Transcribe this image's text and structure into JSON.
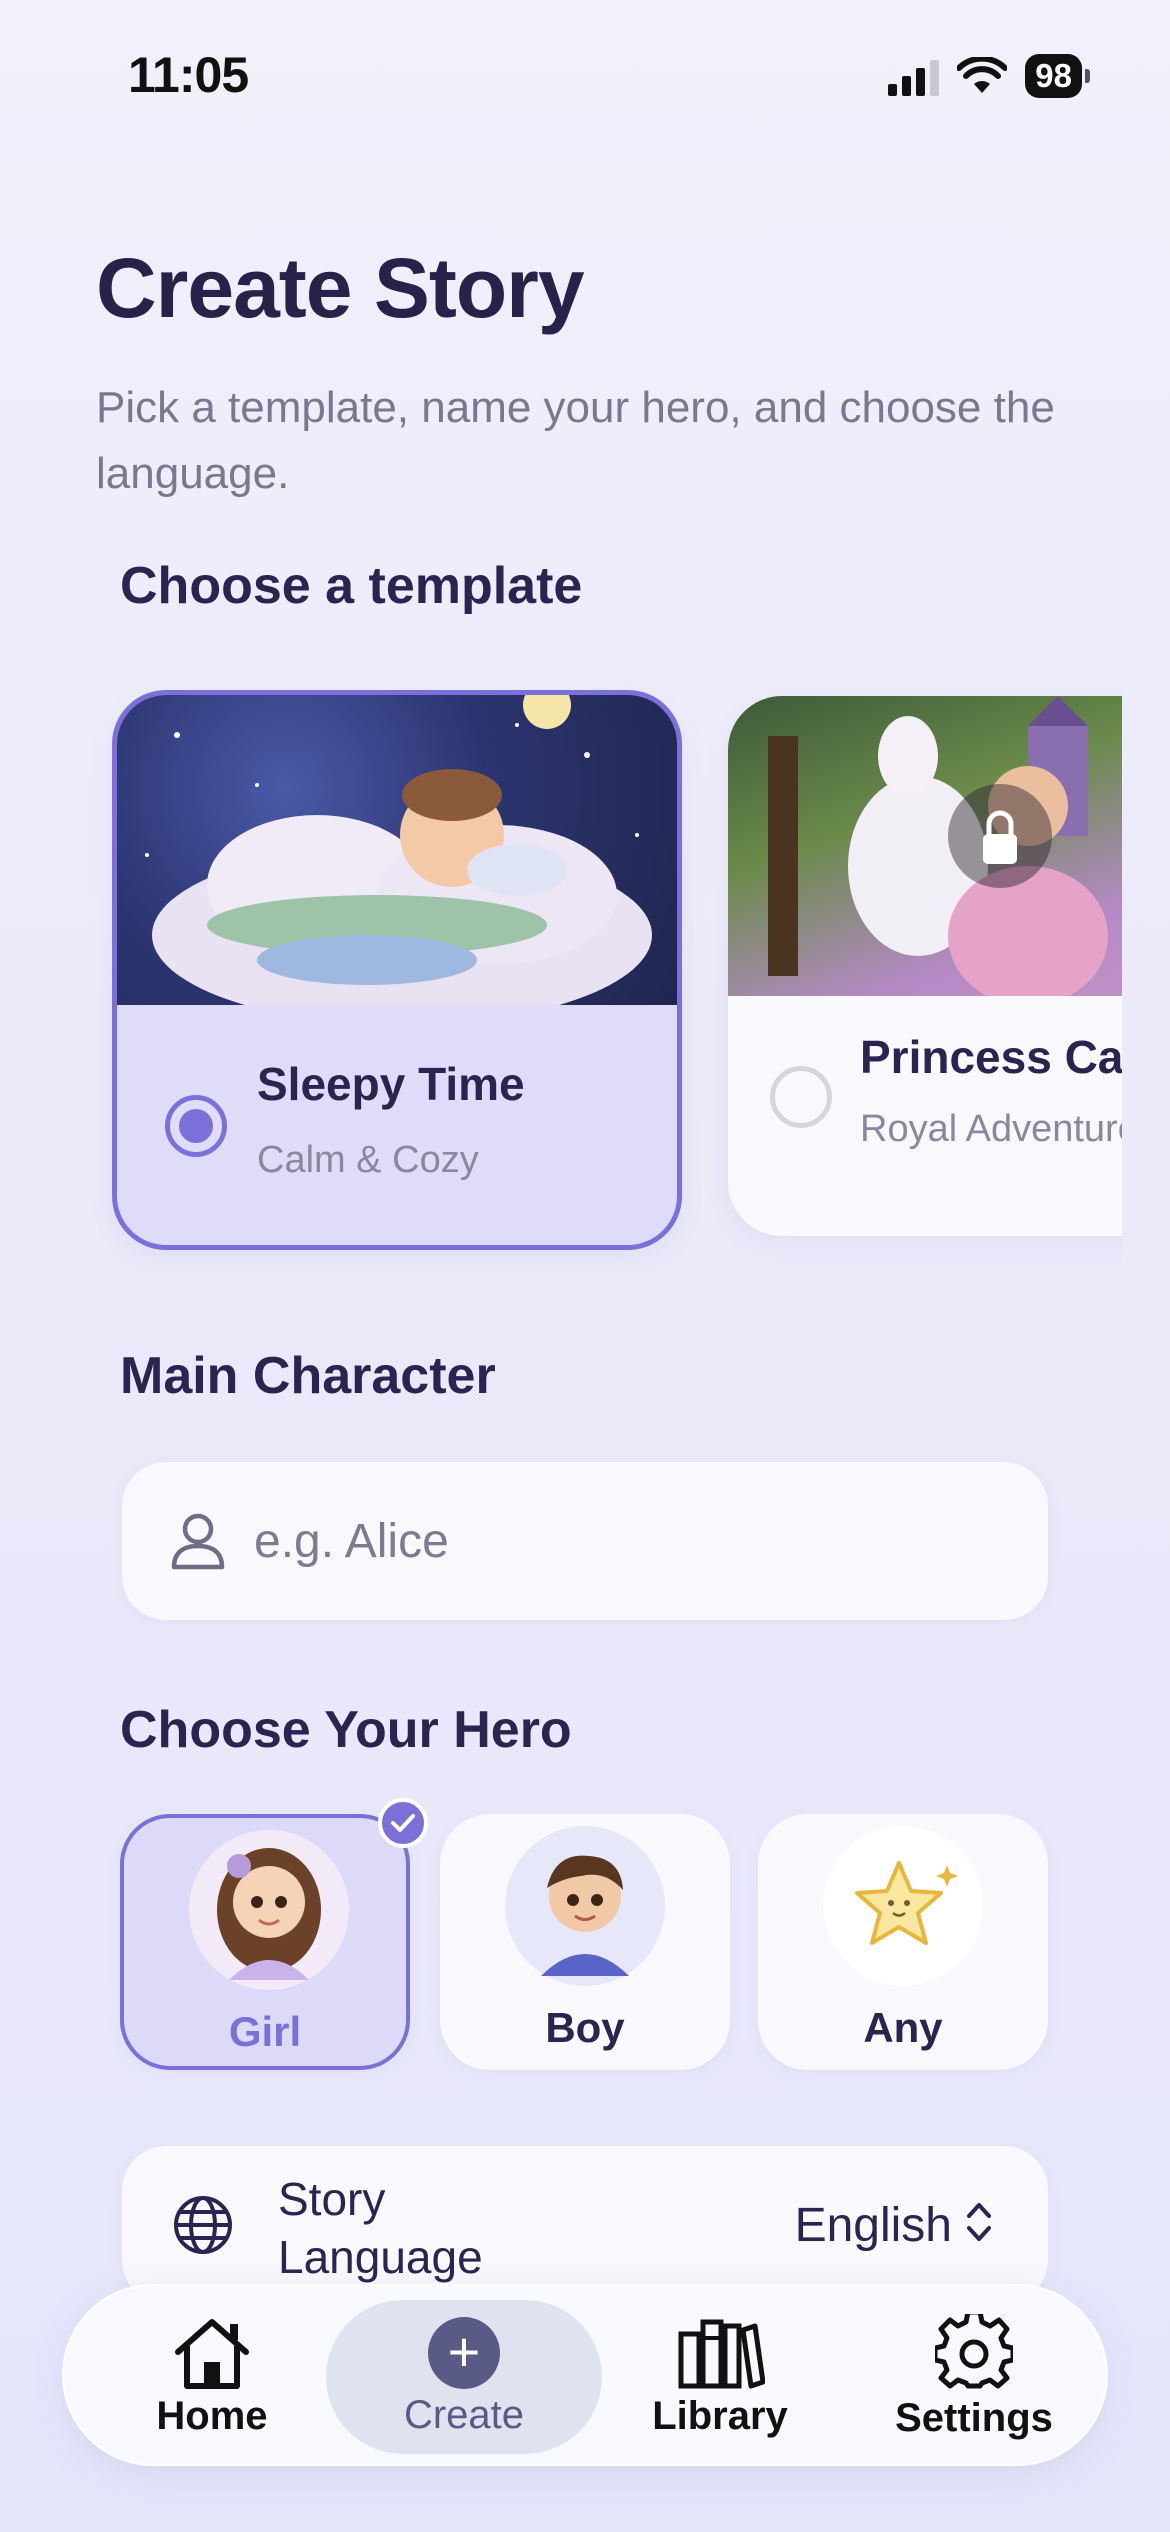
{
  "status_bar": {
    "time": "11:05",
    "battery": "98"
  },
  "header": {
    "title": "Create Story",
    "subtitle": "Pick a template, name your hero, and choose the language."
  },
  "templates": {
    "section_label": "Choose a template",
    "items": [
      {
        "title": "Sleepy Time",
        "subtitle": "Calm & Cozy",
        "selected": true,
        "locked": false
      },
      {
        "title": "Princess Ca",
        "subtitle": "Royal Adventure",
        "selected": false,
        "locked": true
      }
    ]
  },
  "character": {
    "section_label": "Main Character",
    "placeholder": "e.g. Alice",
    "value": ""
  },
  "hero": {
    "section_label": "Choose Your Hero",
    "options": [
      {
        "label": "Girl",
        "selected": true
      },
      {
        "label": "Boy",
        "selected": false
      },
      {
        "label": "Any",
        "selected": false
      }
    ]
  },
  "language": {
    "label": "Story Language",
    "value": "English"
  },
  "tab_bar": {
    "tabs": [
      {
        "label": "Home",
        "icon": "home-icon"
      },
      {
        "label": "Create",
        "icon": "plus-icon",
        "active": true
      },
      {
        "label": "Library",
        "icon": "books-icon"
      },
      {
        "label": "Settings",
        "icon": "gear-icon"
      }
    ]
  },
  "colors": {
    "accent": "#7b6fd9",
    "title": "#27224a",
    "muted": "#7a7890"
  }
}
